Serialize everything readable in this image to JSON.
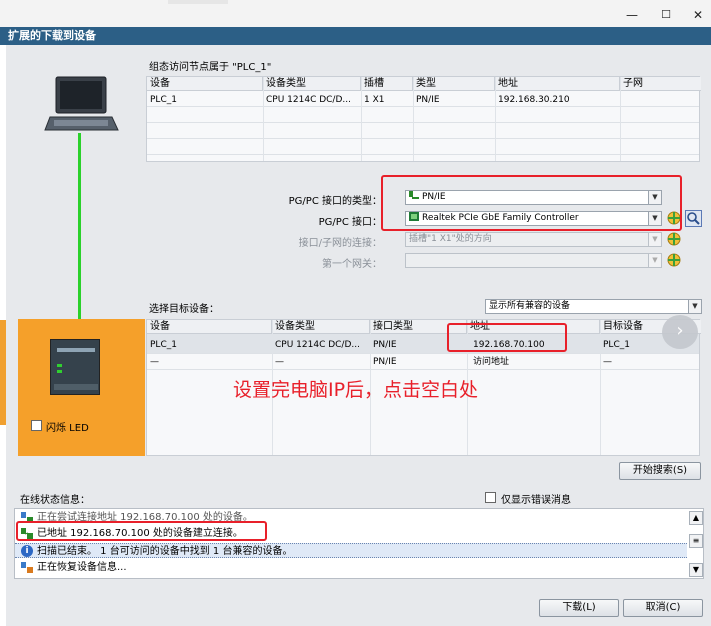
{
  "window": {
    "title": "扩展的下载到设备",
    "minimize_label": "—",
    "maximize_label": "☐",
    "close_label": "✕"
  },
  "pc_section": {
    "header": "组态访问节点属于 \"PLC_1\"",
    "columns": [
      "设备",
      "设备类型",
      "插槽",
      "类型",
      "地址",
      "子网"
    ],
    "rows": [
      [
        "PLC_1",
        "CPU 1214C DC/D...",
        "1 X1",
        "PN/IE",
        "192.168.30.210",
        ""
      ]
    ]
  },
  "interface_form": {
    "type_label": "PG/PC 接口的类型：",
    "type_value": "PN/IE",
    "iface_label": "PG/PC 接口：",
    "iface_value": "Realtek PCIe GbE Family Controller",
    "subnet_label": "接口/子网的连接：",
    "subnet_value": "插槽\"1 X1\"处的方向",
    "gateway_label": "第一个网关：",
    "gateway_value": ""
  },
  "target_section": {
    "label": "选择目标设备：",
    "filter_value": "显示所有兼容的设备",
    "columns": [
      "设备",
      "设备类型",
      "接口类型",
      "地址",
      "目标设备"
    ],
    "rows": [
      [
        "PLC_1",
        "CPU 1214C DC/D...",
        "PN/IE",
        "192.168.70.100",
        "PLC_1"
      ],
      [
        "—",
        "—",
        "PN/IE",
        "访问地址",
        "—"
      ]
    ],
    "flash_led_label": "闪烁 LED",
    "annotation": "设置完电脑IP后，点击空白处",
    "search_button": "开始搜索(S)"
  },
  "online_status": {
    "label": "在线状态信息：",
    "only_errors_label": "仅显示错误消息",
    "messages": [
      {
        "icon": "connecting-icon",
        "text": "正在尝试连接地址 192.168.70.100 处的设备。"
      },
      {
        "icon": "connected-icon",
        "text": "已地址 192.168.70.100 处的设备建立连接。"
      },
      {
        "icon": "info-icon",
        "text": "扫描已结束。 1 台可访问的设备中找到 1 台兼容的设备。"
      },
      {
        "icon": "restore-icon",
        "text": "正在恢复设备信息..."
      }
    ]
  },
  "footer": {
    "download_button": "下载(L)",
    "cancel_button": "取消(C)"
  },
  "colors": {
    "title_bar": "#2c5f86",
    "highlight_box": "#e8202a",
    "orange_panel": "#f5a02a",
    "connection_line": "#2bd12b"
  }
}
